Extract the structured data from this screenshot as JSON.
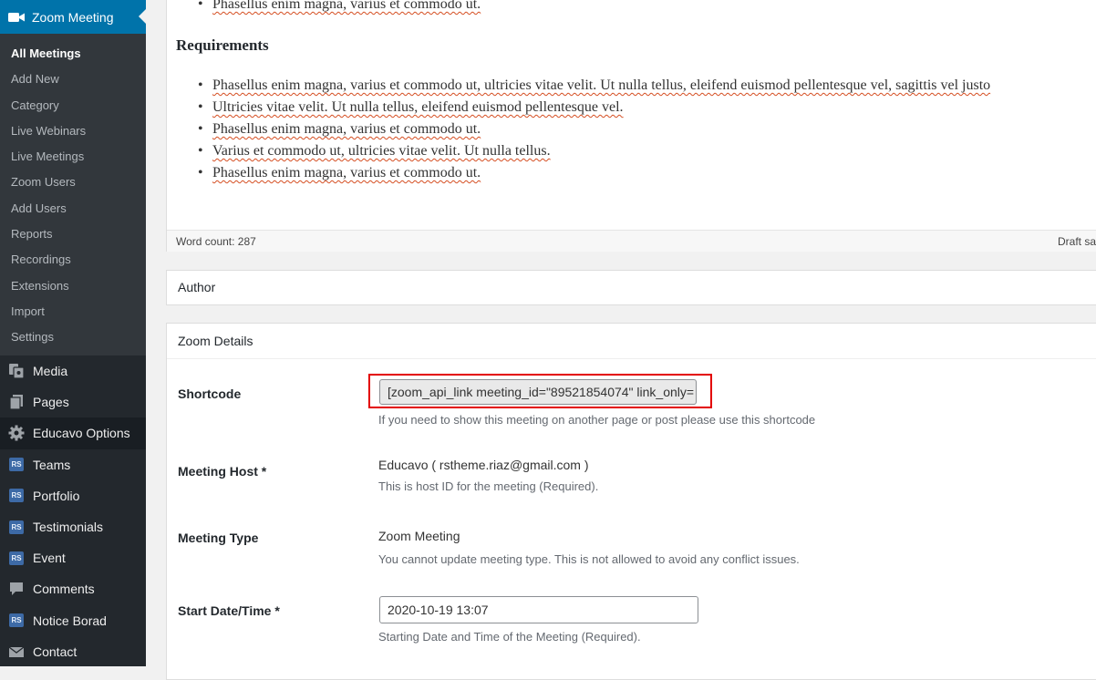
{
  "sidebar": {
    "active_menu": {
      "label": "Zoom Meeting",
      "icon": "video-camera-icon"
    },
    "submenu": [
      "All Meetings",
      "Add New",
      "Category",
      "Live Webinars",
      "Live Meetings",
      "Zoom Users",
      "Add Users",
      "Reports",
      "Recordings",
      "Extensions",
      "Import",
      "Settings"
    ],
    "current_submenu": "All Meetings",
    "items": [
      {
        "label": "Media",
        "icon": "media-icon"
      },
      {
        "label": "Pages",
        "icon": "pages-icon"
      },
      {
        "label": "Educavo Options",
        "icon": "gear-icon"
      },
      {
        "label": "Teams",
        "icon": "rs-icon"
      },
      {
        "label": "Portfolio",
        "icon": "rs-icon"
      },
      {
        "label": "Testimonials",
        "icon": "rs-icon"
      },
      {
        "label": "Event",
        "icon": "rs-icon"
      },
      {
        "label": "Comments",
        "icon": "comment-icon"
      },
      {
        "label": "Notice Borad",
        "icon": "rs-icon"
      },
      {
        "label": "Contact",
        "icon": "mail-icon"
      }
    ],
    "rs_icon_text": "RS"
  },
  "editor": {
    "top_line": "Phasellus enim magna, varius et commodo ut.",
    "requirements_heading": "Requirements",
    "requirements": [
      "Phasellus enim magna, varius et commodo ut, ultricies vitae velit. Ut nulla tellus, eleifend euismod pellentesque vel, sagittis vel justo",
      "Ultricies vitae velit. Ut nulla tellus, eleifend euismod pellentesque vel.",
      "Phasellus enim magna, varius et commodo ut.",
      "Varius et commodo ut, ultricies vitae velit. Ut nulla tellus.",
      "Phasellus enim magna, varius et commodo ut."
    ],
    "word_count": "Word count: 287",
    "draft_status": "Draft saved"
  },
  "author_box": {
    "title": "Author"
  },
  "zoom_details": {
    "title": "Zoom Details",
    "shortcode": {
      "label": "Shortcode",
      "value": "[zoom_api_link meeting_id=\"89521854074\" link_only=",
      "description": "If you need to show this meeting on another page or post please use this shortcode"
    },
    "meeting_host": {
      "label": "Meeting Host *",
      "value": "Educavo ( rstheme.riaz@gmail.com )",
      "description": "This is host ID for the meeting (Required)."
    },
    "meeting_type": {
      "label": "Meeting Type",
      "value": "Zoom Meeting",
      "description": "You cannot update meeting type. This is not allowed to avoid any conflict issues."
    },
    "start_date": {
      "label": "Start Date/Time *",
      "value": "2020-10-19 13:07",
      "description": "Starting Date and Time of the Meeting (Required)."
    }
  },
  "colors": {
    "sidebar_bg": "#23282d",
    "active_blue": "#0073aa",
    "highlight_red": "#e30000"
  }
}
